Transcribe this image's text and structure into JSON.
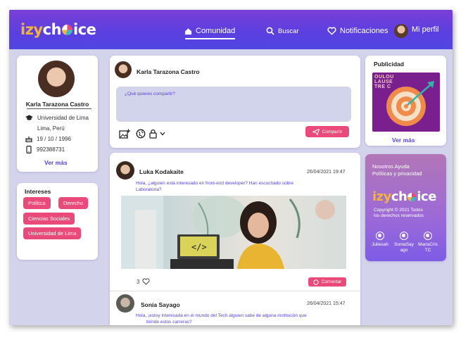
{
  "nav": {
    "logo_prefix": "izy",
    "logo_mid": "ch",
    "logo_suffix": "ice",
    "items": [
      {
        "label": "Comunidad",
        "icon": "home-icon"
      },
      {
        "label": "Buscar",
        "icon": "search-icon"
      },
      {
        "label": "Notificaciones",
        "icon": "heart-icon"
      },
      {
        "label": "Mi perfil",
        "icon": "avatar"
      }
    ]
  },
  "profile": {
    "name": "Karla Tarazona Castro",
    "university": "Universidad de Lima",
    "location": "Lima, Perú",
    "birthdate": "19 / 10 / 1996",
    "phone": "992388731",
    "see_more": "Ver más"
  },
  "interests": {
    "title": "Intereses",
    "tags": [
      "Política",
      "Derecho",
      "Ciencias Sociales",
      "Universidad de Lima"
    ]
  },
  "compose": {
    "user": "Karla Tarazona Castro",
    "placeholder": "¿Qué quieres compartir?",
    "share_label": "Compartir"
  },
  "posts": [
    {
      "author": "Luka Kodakaite",
      "date": "26/04/2021 19:47",
      "text_line1": "Hola, ¿alguien está interesado en front-end developer? Han escuchado sobre",
      "text_line2": "Laboratoria?",
      "likes": "3",
      "comment_label": "Comentar"
    },
    {
      "author": "Sonia Sayago",
      "date": "26/04/2021 15:47",
      "text_line1": "Hola, ¡estoy interesada en el mundo del Tech alguien sabe de alguna institución que",
      "text_line2": "brinde estos carreras?"
    }
  ],
  "ads": {
    "title": "Publicidad",
    "ad_text": "OULOU LAUSE TRE C",
    "see_more": "Ver más"
  },
  "footer": {
    "links_line1": "Nosotros  Ayuda",
    "links_line2": "Políticas y privacidad",
    "copyright_line1": "Copyright ©  2021 Todos",
    "copyright_line2": "los derechos reservados",
    "socials": [
      {
        "name": "Juliesah"
      },
      {
        "name": "SoniaSay ago"
      },
      {
        "name": "MariaCris TC"
      }
    ]
  },
  "colors": {
    "nav_start": "#7a3fd6",
    "nav_end": "#5147e3",
    "accent_pink": "#e94a7a",
    "accent_purple": "#5a3fd6",
    "background": "#d4d3ec"
  }
}
